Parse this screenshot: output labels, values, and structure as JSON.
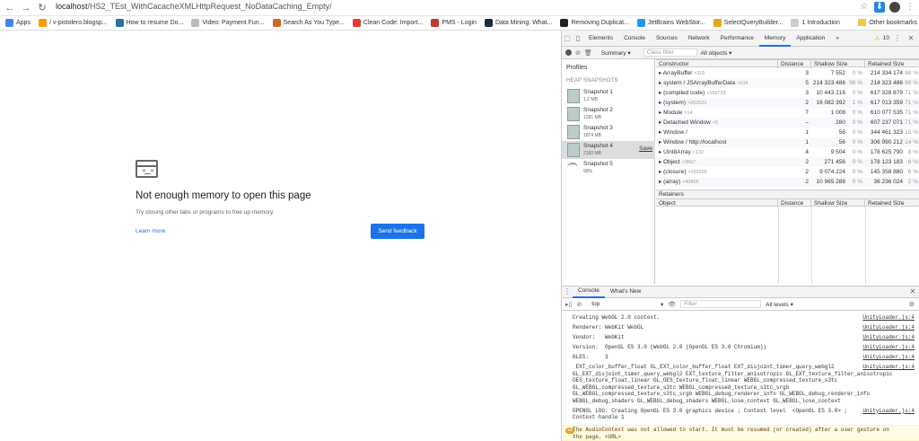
{
  "browser": {
    "url_host": "localhost",
    "url_path": "/HS2_TEst_WithCacacheXMLHttpRequest_NoDataCaching_Empty/",
    "bookmarks": [
      {
        "label": "Apps",
        "color": "#4285f4"
      },
      {
        "label": "/ v-pistolero.blogsp...",
        "color": "#ff9800"
      },
      {
        "label": "How to resume Do...",
        "color": "#21759b"
      },
      {
        "label": "Video: Payment Fun...",
        "color": "#bbbbbb"
      },
      {
        "label": "Search As You Type...",
        "color": "#d2691e"
      },
      {
        "label": "Clean Code: Import...",
        "color": "#e53935"
      },
      {
        "label": "PMS - Login",
        "color": "#c0392b"
      },
      {
        "label": "Data Mining: What...",
        "color": "#1b2a4a"
      },
      {
        "label": "Removing Duplicat...",
        "color": "#222222"
      },
      {
        "label": "JetBrains WebStor...",
        "color": "#2196f3"
      },
      {
        "label": "SelectQueryBuilder...",
        "color": "#e6a817"
      },
      {
        "label": "1 Introduction",
        "color": "#cccccc"
      }
    ],
    "other_bookmarks": "Other bookmarks"
  },
  "error_page": {
    "title": "Not enough memory to open this page",
    "subtitle": "Try closing other tabs or programs to free up memory.",
    "learn_more": "Learn more",
    "send_feedback": "Send feedback"
  },
  "devtools": {
    "tabs": [
      "Elements",
      "Console",
      "Sources",
      "Network",
      "Performance",
      "Memory",
      "Application"
    ],
    "active_tab": "Memory",
    "more_tabs": "»",
    "warning_count": "10",
    "toolbar": {
      "view": "Summary",
      "class_filter_placeholder": "Class filter",
      "objects": "All objects"
    },
    "profiles_title": "Profiles",
    "heap_snapshots_label": "HEAP SNAPSHOTS",
    "snapshots": [
      {
        "name": "Snapshot 1",
        "size": "1.2 MB",
        "selected": false
      },
      {
        "name": "Snapshot 2",
        "size": "1281 MB",
        "selected": false
      },
      {
        "name": "Snapshot 3",
        "size": "1874 MB",
        "selected": false
      },
      {
        "name": "Snapshot 4",
        "size": "2160 MB",
        "selected": true,
        "save": "Save"
      },
      {
        "name": "Snapshot 5",
        "size": "99%",
        "selected": false
      }
    ],
    "columns": {
      "constructor": "Constructor",
      "distance": "Distance",
      "shallow": "Shallow Size",
      "retained": "Retained Size"
    },
    "rows": [
      {
        "name": "ArrayBuffer",
        "count": "×119",
        "distance": "3",
        "shallow": "7 552",
        "shallow_pct": "0 %",
        "retained": "214 334 174",
        "retained_pct": "98 %"
      },
      {
        "name": "system / JSArrayBufferData",
        "count": "×104",
        "distance": "5",
        "shallow": "214 323 486",
        "shallow_pct": "98 %",
        "retained": "214 323 486",
        "retained_pct": "98 %"
      },
      {
        "name": "(compiled code)",
        "count": "×155723",
        "distance": "3",
        "shallow": "10 443 216",
        "shallow_pct": "0 %",
        "retained": "617 328 879",
        "retained_pct": "71 %"
      },
      {
        "name": "(system)",
        "count": "×262631",
        "distance": "2",
        "shallow": "16 082 392",
        "shallow_pct": "1 %",
        "retained": "617 013 359",
        "retained_pct": "71 %"
      },
      {
        "name": "Module",
        "count": "×14",
        "distance": "7",
        "shallow": "1 008",
        "shallow_pct": "0 %",
        "retained": "610 077 535",
        "retained_pct": "71 %"
      },
      {
        "name": "Detached Window",
        "count": "×5",
        "distance": "–",
        "shallow": "280",
        "shallow_pct": "0 %",
        "retained": "607 237 071",
        "retained_pct": "71 %"
      },
      {
        "name": "Window /",
        "count": "",
        "distance": "1",
        "shallow": "56",
        "shallow_pct": "0 %",
        "retained": "344 461 323",
        "retained_pct": "15 %"
      },
      {
        "name": "Window / http://localhost",
        "count": "",
        "distance": "1",
        "shallow": "56",
        "shallow_pct": "0 %",
        "retained": "306 990 212",
        "retained_pct": "14 %"
      },
      {
        "name": "Uint8Array",
        "count": "×132",
        "distance": "4",
        "shallow": "9 504",
        "shallow_pct": "0 %",
        "retained": "178 625 790",
        "retained_pct": "8 %"
      },
      {
        "name": "Object",
        "count": "×3567",
        "distance": "2",
        "shallow": "271 456",
        "shallow_pct": "0 %",
        "retained": "178 123 183",
        "retained_pct": "8 %"
      },
      {
        "name": "(closure)",
        "count": "×159935",
        "distance": "2",
        "shallow": "9 074 224",
        "shallow_pct": "0 %",
        "retained": "145 358 880",
        "retained_pct": "6 %"
      },
      {
        "name": "(array)",
        "count": "×49805",
        "distance": "2",
        "shallow": "10 965 288",
        "shallow_pct": "0 %",
        "retained": "36 236 024",
        "retained_pct": "2 %"
      }
    ],
    "retainers_label": "Retainers",
    "retainer_columns": {
      "object": "Object",
      "distance": "Distance",
      "shallow": "Shallow Size",
      "retained": "Retained Size"
    },
    "console_tabs": [
      "Console",
      "What's New"
    ],
    "console_toolbar": {
      "context": "top",
      "filter_placeholder": "Filter",
      "levels": "All levels ▾"
    },
    "console_lines": [
      {
        "text": "Creating WebGL 2.0 context.",
        "src": "UnityLoader.js:4"
      },
      {
        "text": "Renderer: WebKit WebGL",
        "src": "UnityLoader.js:4"
      },
      {
        "text": "Vendor:   WebKit",
        "src": "UnityLoader.js:4"
      },
      {
        "text": "Version:  OpenGL ES 3.0 (WebGL 2.0 (OpenGL ES 3.0 Chromium))",
        "src": "UnityLoader.js:4"
      },
      {
        "text": "GLES:     3",
        "src": "UnityLoader.js:4"
      },
      {
        "text": " EXT_color_buffer_float GL_EXT_color_buffer_float EXT_disjoint_timer_query_webgl2\nGL_EXT_disjoint_timer_query_webgl2 EXT_texture_filter_anisotropic GL_EXT_texture_filter_anisotropic\nOES_texture_float_linear GL_OES_texture_float_linear WEBGL_compressed_texture_s3tc\nGL_WEBGL_compressed_texture_s3tc WEBGL_compressed_texture_s3tc_srgb\nGL_WEBGL_compressed_texture_s3tc_srgb WEBGL_debug_renderer_info GL_WEBGL_debug_renderer_info\nWEBGL_debug_shaders GL_WEBGL_debug_shaders WEBGL_lose_context GL_WEBGL_lose_context",
        "src": "UnityLoader.js:4"
      },
      {
        "text": "OPENGL LOG: Creating OpenGL ES 3.0 graphics device ; Context level  <OpenGL ES 3.0> ;\nContext handle 1",
        "src": "UnityLoader.js:4"
      }
    ],
    "warning": {
      "badge": "10",
      "text": "The AudioContext was not allowed to start. It must be resumed (or created) after a user gesture on\nthe page. <URL>"
    }
  }
}
